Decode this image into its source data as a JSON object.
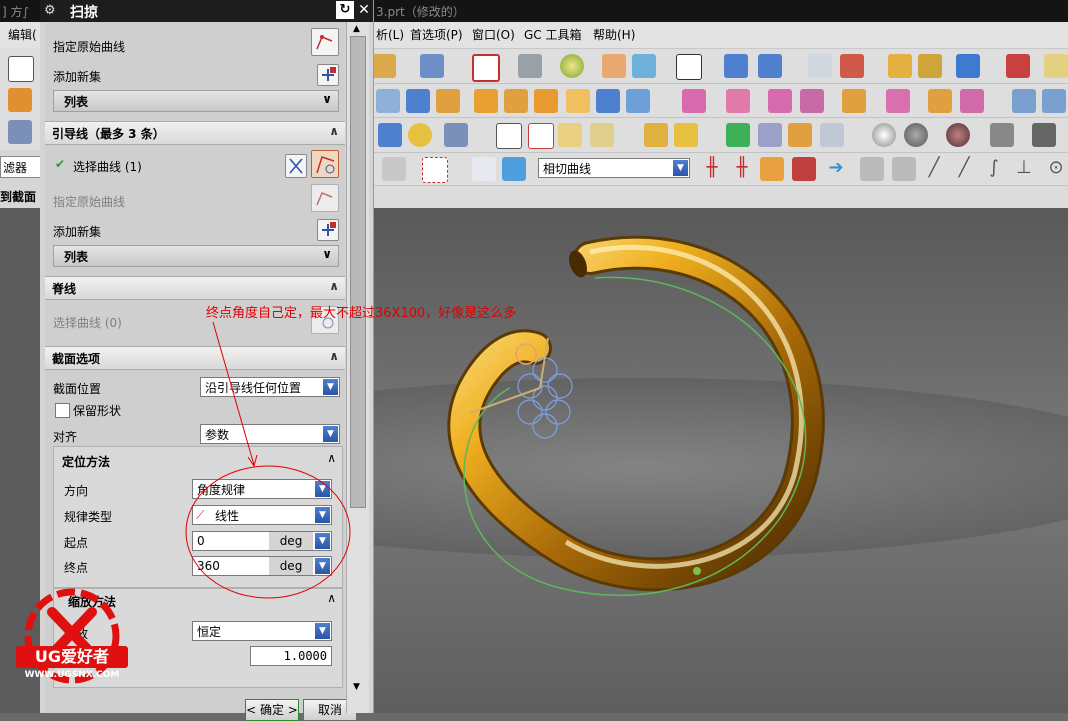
{
  "window": {
    "left_fragment": "] 方∫",
    "file_title": "3.prt（修改的）"
  },
  "menu": {
    "items": [
      "编辑(",
      "析(L)",
      "首选项(P)",
      "窗口(O)",
      "GC 工具箱",
      "帮助(H)"
    ]
  },
  "left_fragments": {
    "filter": "滤器",
    "section": "到截面"
  },
  "toolbar": {
    "curve_combo": "相切曲线"
  },
  "dialog": {
    "title": "扫掠",
    "section1": {
      "specify_curve": "指定原始曲线",
      "add_set": "添加新集",
      "list": "列表"
    },
    "guides": {
      "header": "引导线（最多 3 条）",
      "select_curve": "选择曲线 (1)",
      "specify_curve": "指定原始曲线",
      "add_set": "添加新集",
      "list": "列表"
    },
    "spine": {
      "header": "脊线",
      "select_curve": "选择曲线 (0)"
    },
    "section_options": {
      "header": "截面选项",
      "position_label": "截面位置",
      "position_value": "沿引导线任何位置",
      "preserve_shape": "保留形状",
      "align_label": "对齐",
      "align_value": "参数",
      "orientation": {
        "header": "定位方法",
        "direction_label": "方向",
        "direction_value": "角度规律",
        "law_label": "规律类型",
        "law_value": "线性",
        "start_label": "起点",
        "start_value": "0",
        "start_unit": "deg",
        "end_label": "终点",
        "end_value": "360",
        "end_unit": "deg"
      },
      "scaling": {
        "header": "缩放方法",
        "scale_label": "缩放",
        "scale_value": "恒定",
        "factor_value": "1.0000"
      }
    },
    "ok_button": "< 确定 >",
    "cancel_button": "取消"
  },
  "annotation": {
    "text": "终点角度自己定，最大不超过36X100，好像是这么多"
  },
  "watermark": {
    "brand": "UG爱好者",
    "url": "WWW.UGSNX.COM"
  },
  "colors": {
    "annotation": "#e00000",
    "ring": "#e0a020",
    "guide_curve": "#4caf50"
  }
}
